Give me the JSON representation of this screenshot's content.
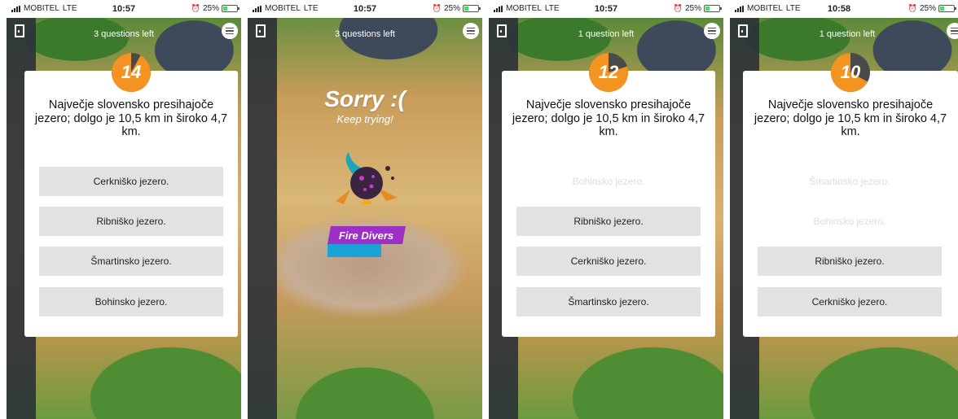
{
  "status": {
    "carrier": "MOBITEL",
    "network": "LTE",
    "battery": "25%"
  },
  "colors": {
    "timer_orange": "#f39322",
    "timer_dark": "#4a4a4a",
    "answer_bg": "#e2e2e2",
    "banner_purple": "#9b2fc6",
    "bar_blue": "#1aa3d9"
  },
  "screens": [
    {
      "time": "10:57",
      "questions_left": "3 questions left",
      "timer": "14",
      "timer_remaining": 0.92,
      "question": "Največje slovensko presihajoče jezero; dolgo je 10,5 km in široko 4,7 km.",
      "answers": [
        {
          "label": "Cerkniško jezero.",
          "faded": false
        },
        {
          "label": "Ribniško jezero.",
          "faded": false
        },
        {
          "label": "Šmartinsko jezero.",
          "faded": false
        },
        {
          "label": "Bohinsko jezero.",
          "faded": false
        }
      ]
    },
    {
      "time": "10:57",
      "questions_left": "3 questions left",
      "sorry_title": "Sorry :(",
      "sorry_sub": "Keep trying!",
      "team": "Fire Divers"
    },
    {
      "time": "10:57",
      "questions_left": "1 question left",
      "timer": "12",
      "timer_remaining": 0.8,
      "question": "Največje slovensko presihajoče jezero; dolgo je 10,5 km in široko 4,7 km.",
      "answers": [
        {
          "label": "Bohinsko jezero.",
          "faded": true
        },
        {
          "label": "Ribniško jezero.",
          "faded": false
        },
        {
          "label": "Cerkniško jezero.",
          "faded": false
        },
        {
          "label": "Šmartinsko jezero.",
          "faded": false
        }
      ]
    },
    {
      "time": "10:58",
      "questions_left": "1 question left",
      "timer": "10",
      "timer_remaining": 0.67,
      "question": "Največje slovensko presihajoče jezero; dolgo je 10,5 km in široko 4,7 km.",
      "answers": [
        {
          "label": "Šmartinsko jezero.",
          "faded": true
        },
        {
          "label": "Bohinsko jezero.",
          "faded": true
        },
        {
          "label": "Ribniško jezero.",
          "faded": false
        },
        {
          "label": "Cerkniško jezero.",
          "faded": false
        }
      ]
    }
  ]
}
